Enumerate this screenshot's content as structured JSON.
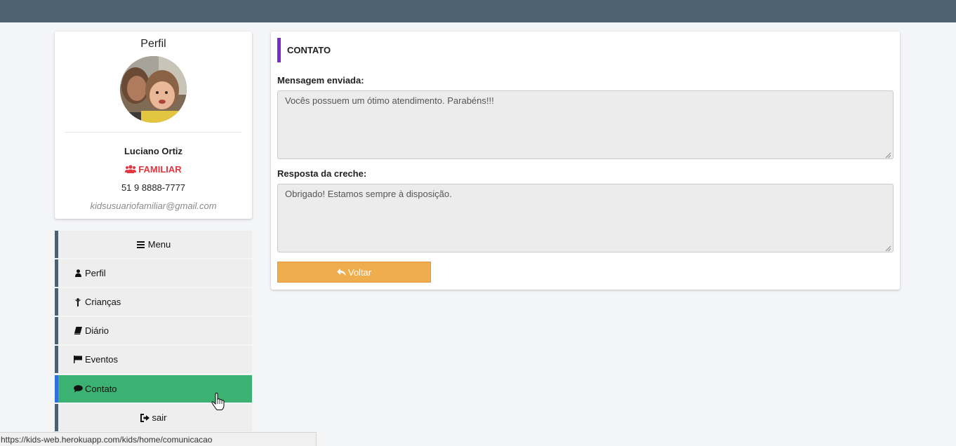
{
  "profile": {
    "title": "Perfil",
    "name": "Luciano Ortiz",
    "role": "FAMILIAR",
    "phone": "51 9 8888-7777",
    "email": "kidsusuariofamiliar@gmail.com",
    "role_icon": "users-icon"
  },
  "menu": {
    "header": "Menu",
    "items": [
      {
        "label": "Perfil",
        "icon": "user-icon"
      },
      {
        "label": "Crianças",
        "icon": "child-icon"
      },
      {
        "label": "Diário",
        "icon": "book-icon"
      },
      {
        "label": "Eventos",
        "icon": "flag-icon"
      },
      {
        "label": "Contato",
        "icon": "comment-icon",
        "active": true
      }
    ],
    "logout": "sair"
  },
  "contact": {
    "title": "CONTATO",
    "sent_label": "Mensagem enviada:",
    "sent_message": "Vocês possuem um ótimo atendimento. Parabéns!!!",
    "reply_label": "Resposta da creche:",
    "reply_message": "Obrigado! Estamos sempre à disposição.",
    "back_button": "Voltar"
  },
  "statusbar": {
    "url": "https://kids-web.herokuapp.com/kids/home/comunicacao"
  },
  "colors": {
    "topbar": "#4d6270",
    "active_menu": "#3bb271",
    "accent_purple": "#7a2cc9",
    "role_red": "#e2383f",
    "button_orange": "#efad4e"
  }
}
